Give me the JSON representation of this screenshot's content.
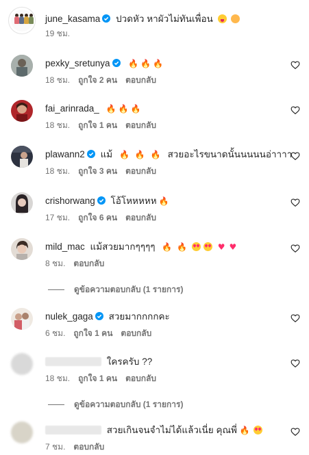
{
  "caption": {
    "username": "june_kasama",
    "verified": true,
    "text": "ปวดหัว หาผัวไม่ทันเพื่อน",
    "time": "19 ชม."
  },
  "labels": {
    "reply": "ตอบกลับ",
    "view_replies": "ดูข้อความตอบกลับ (1 รายการ)"
  },
  "comments": [
    {
      "username": "pexky_sretunya",
      "verified": true,
      "text": "",
      "emojis": [
        "fire",
        "fire",
        "fire"
      ],
      "time": "18 ชม.",
      "likes": "ถูกใจ 2 คน",
      "avatar_color": "#9aa3a0"
    },
    {
      "username": "fai_arinrada_",
      "verified": false,
      "text": "",
      "emojis": [
        "fire",
        "fire",
        "fire"
      ],
      "time": "18 ชม.",
      "likes": "ถูกใจ 1 คน",
      "avatar_color": "#b0262a"
    },
    {
      "username": "plawann2",
      "verified": true,
      "text": "แม้",
      "emojis": [
        "fire",
        "fire",
        "fire"
      ],
      "text2": "สวยอะไรขนาดนั้นนนนนอ่าาาา",
      "time": "18 ชม.",
      "likes": "ถูกใจ 3 คน",
      "avatar_color": "#2d3240"
    },
    {
      "username": "crishorwang",
      "verified": true,
      "text": "โอ้โหหหหห",
      "emojis": [
        "fire"
      ],
      "time": "17 ชม.",
      "likes": "ถูกใจ 6 คน",
      "avatar_color": "#3a3436"
    },
    {
      "username": "mild_mac",
      "verified": false,
      "text": "แม้สวยมากๆๆๆๆ",
      "emojis": [
        "fire",
        "fire",
        "hearteyes",
        "hearteyes",
        "heart",
        "heart"
      ],
      "time": "8 ชม.",
      "likes": "",
      "avatar_color": "#c9bfb6"
    },
    {
      "username": "nulek_gaga",
      "verified": true,
      "text": "สวยมากกกกคะ",
      "emojis": [],
      "time": "6 ชม.",
      "likes": "ถูกใจ 1 คน",
      "avatar_color": "#b5a592"
    },
    {
      "username": "",
      "verified": false,
      "text": "ใครครับ ??",
      "emojis": [],
      "time": "18 ชม.",
      "likes": "ถูกใจ 1 คน",
      "avatar_color": "#d9d9d9"
    },
    {
      "username": "",
      "verified": false,
      "text": "สวยเกินจนจำไม่ได้แล้วเนี่ย คุณพี่",
      "emojis": [
        "fire",
        "hearteyes"
      ],
      "time": "7 ชม.",
      "likes": "",
      "avatar_color": "#d8d4c8"
    }
  ],
  "colors": {
    "verified": "#0095f6",
    "fire": "#f06a00",
    "heart": "#ff2d6b",
    "secondary_text": "#737373"
  }
}
